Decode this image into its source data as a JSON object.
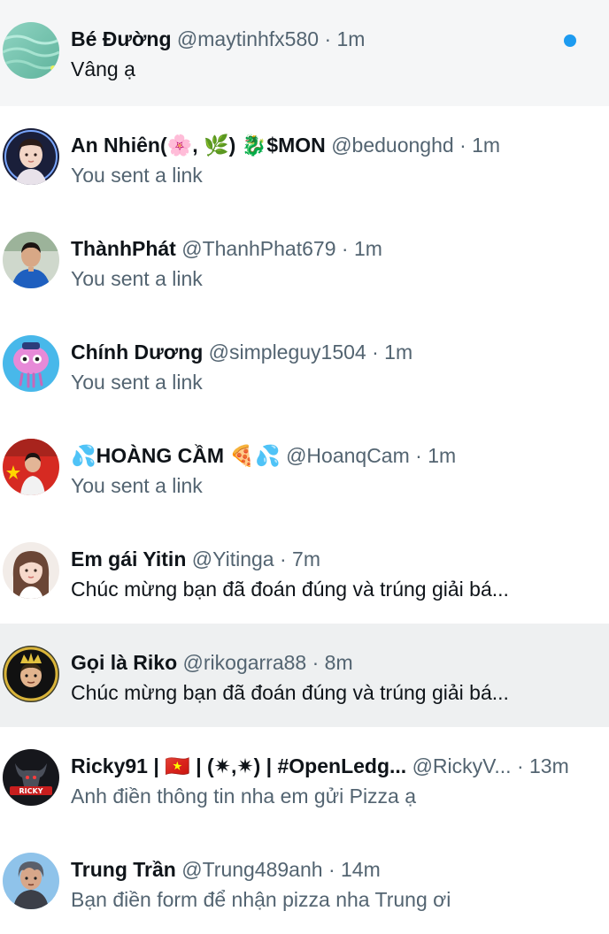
{
  "conversations": [
    {
      "name": "Bé Đường",
      "handle": "@maytinhfx580",
      "separator": "·",
      "time": "1m",
      "preview": "Vâng ạ",
      "unread": true,
      "avatar_icon": "green-water-avatar"
    },
    {
      "name": "An Nhiên(🌸, 🌿) 🐉$MON",
      "handle": "@beduonghd",
      "separator": "·",
      "time": "1m",
      "preview": "You sent a link",
      "avatar_icon": "girl-avatar"
    },
    {
      "name": "ThànhPhát",
      "handle": "@ThanhPhat679",
      "separator": "·",
      "time": "1m",
      "preview": "You sent a link",
      "avatar_icon": "boy-blue-shirt-avatar"
    },
    {
      "name": "Chính Dương",
      "handle": "@simpleguy1504",
      "separator": "·",
      "time": "1m",
      "preview": "You sent a link",
      "avatar_icon": "cartoon-creature-avatar"
    },
    {
      "name": "💦HOÀNG CẦM 🍕💦",
      "handle": "@HoanqCam",
      "separator": "·",
      "time": "1m",
      "preview": "You sent a link",
      "avatar_icon": "flag-crowd-avatar"
    },
    {
      "name": "Em gái Yitin",
      "handle": "@Yitinga",
      "separator": "·",
      "time": "7m",
      "preview": "Chúc mừng bạn đã đoán đúng và trúng giải bá...",
      "avatar_icon": "girl-selfie-avatar"
    },
    {
      "name": "Gọi là Riko",
      "handle": "@rikogarra88",
      "separator": "·",
      "time": "8m",
      "preview": "Chúc mừng bạn đã đoán đúng và trúng giải bá...",
      "hover": true,
      "avatar_icon": "crowned-character-avatar"
    },
    {
      "name": "Ricky91 | 🇻🇳 | (✷,✷) | #OpenLedg...",
      "handle": "@RickyV...",
      "separator": "·",
      "time": "13m",
      "preview": "Anh điền thông tin nha em gửi Pizza ạ",
      "avatar_icon": "ricky-bull-logo-avatar"
    },
    {
      "name": "Trung Trần",
      "handle": "@Trung489anh",
      "separator": "·",
      "time": "14m",
      "preview": "Bạn điền form để nhận pizza nha Trung ơi",
      "avatar_icon": "anime-boy-avatar"
    }
  ],
  "colors": {
    "accent": "#1d9bf0",
    "unread_bg": "#f5f6f7",
    "hover_bg": "#eef0f1",
    "secondary_text": "#536471",
    "primary_text": "#0f1419"
  }
}
